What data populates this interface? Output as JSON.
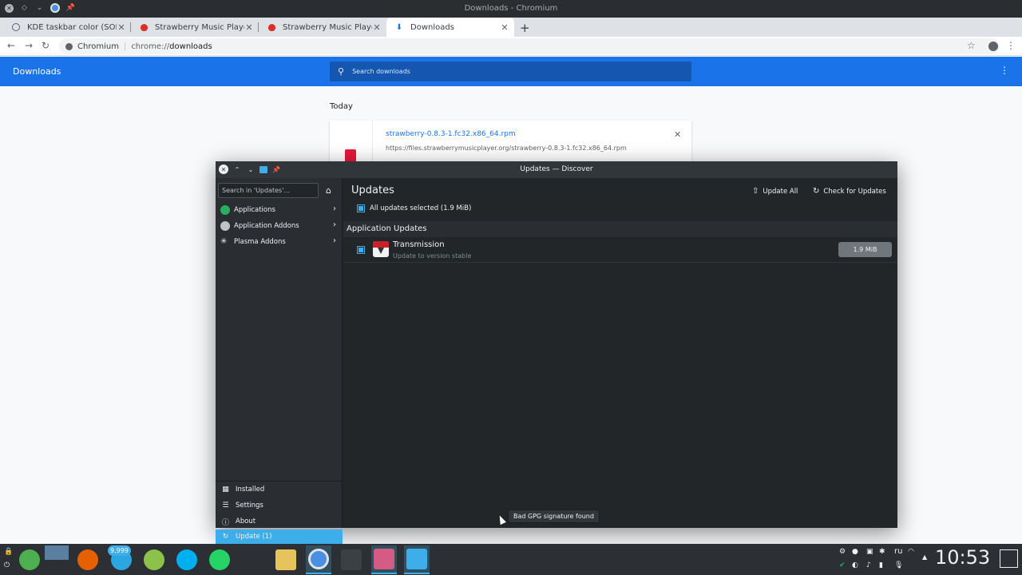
{
  "chromium": {
    "window_title": "Downloads - Chromium",
    "tabs": [
      {
        "title": "KDE taskbar color (SOLVED",
        "icon": "globe-icon"
      },
      {
        "title": "Strawberry Music Player",
        "icon": "strawberry-icon"
      },
      {
        "title": "Strawberry Music Player",
        "icon": "strawberry-icon"
      },
      {
        "title": "Downloads",
        "icon": "download-icon"
      }
    ],
    "omnibox": {
      "site": "Chromium",
      "scheme": "chrome://",
      "host": "downloads"
    }
  },
  "downloads": {
    "title": "Downloads",
    "search_placeholder": "Search downloads",
    "section": "Today",
    "item": {
      "filename": "strawberry-0.8.3-1.fc32.x86_64.rpm",
      "url": "https://files.strawberrymusicplayer.org/strawberry-0.8.3-1.fc32.x86_64.rpm"
    }
  },
  "discover": {
    "window_title": "Updates — Discover",
    "search_placeholder": "Search in 'Updates'...",
    "categories": [
      {
        "label": "Applications"
      },
      {
        "label": "Application Addons"
      },
      {
        "label": "Plasma Addons"
      }
    ],
    "bottom_nav": [
      {
        "label": "Installed"
      },
      {
        "label": "Settings"
      },
      {
        "label": "About"
      },
      {
        "label": "Update (1)"
      }
    ],
    "page_title": "Updates",
    "update_all": "Update All",
    "check_updates": "Check for Updates",
    "all_selected": "All updates selected (1.9 MiB)",
    "section_header": "Application Updates",
    "app": {
      "name": "Transmission",
      "desc": "Update to version stable",
      "size": "1.9 MiB"
    },
    "tooltip": "Bad GPG signature found"
  },
  "panel": {
    "badge": "9,999",
    "language": "ru",
    "clock": "10:53"
  },
  "colors": {
    "chrome_blue": "#1a73e8",
    "kde_accent": "#3daee9",
    "kde_dark": "#232629"
  }
}
